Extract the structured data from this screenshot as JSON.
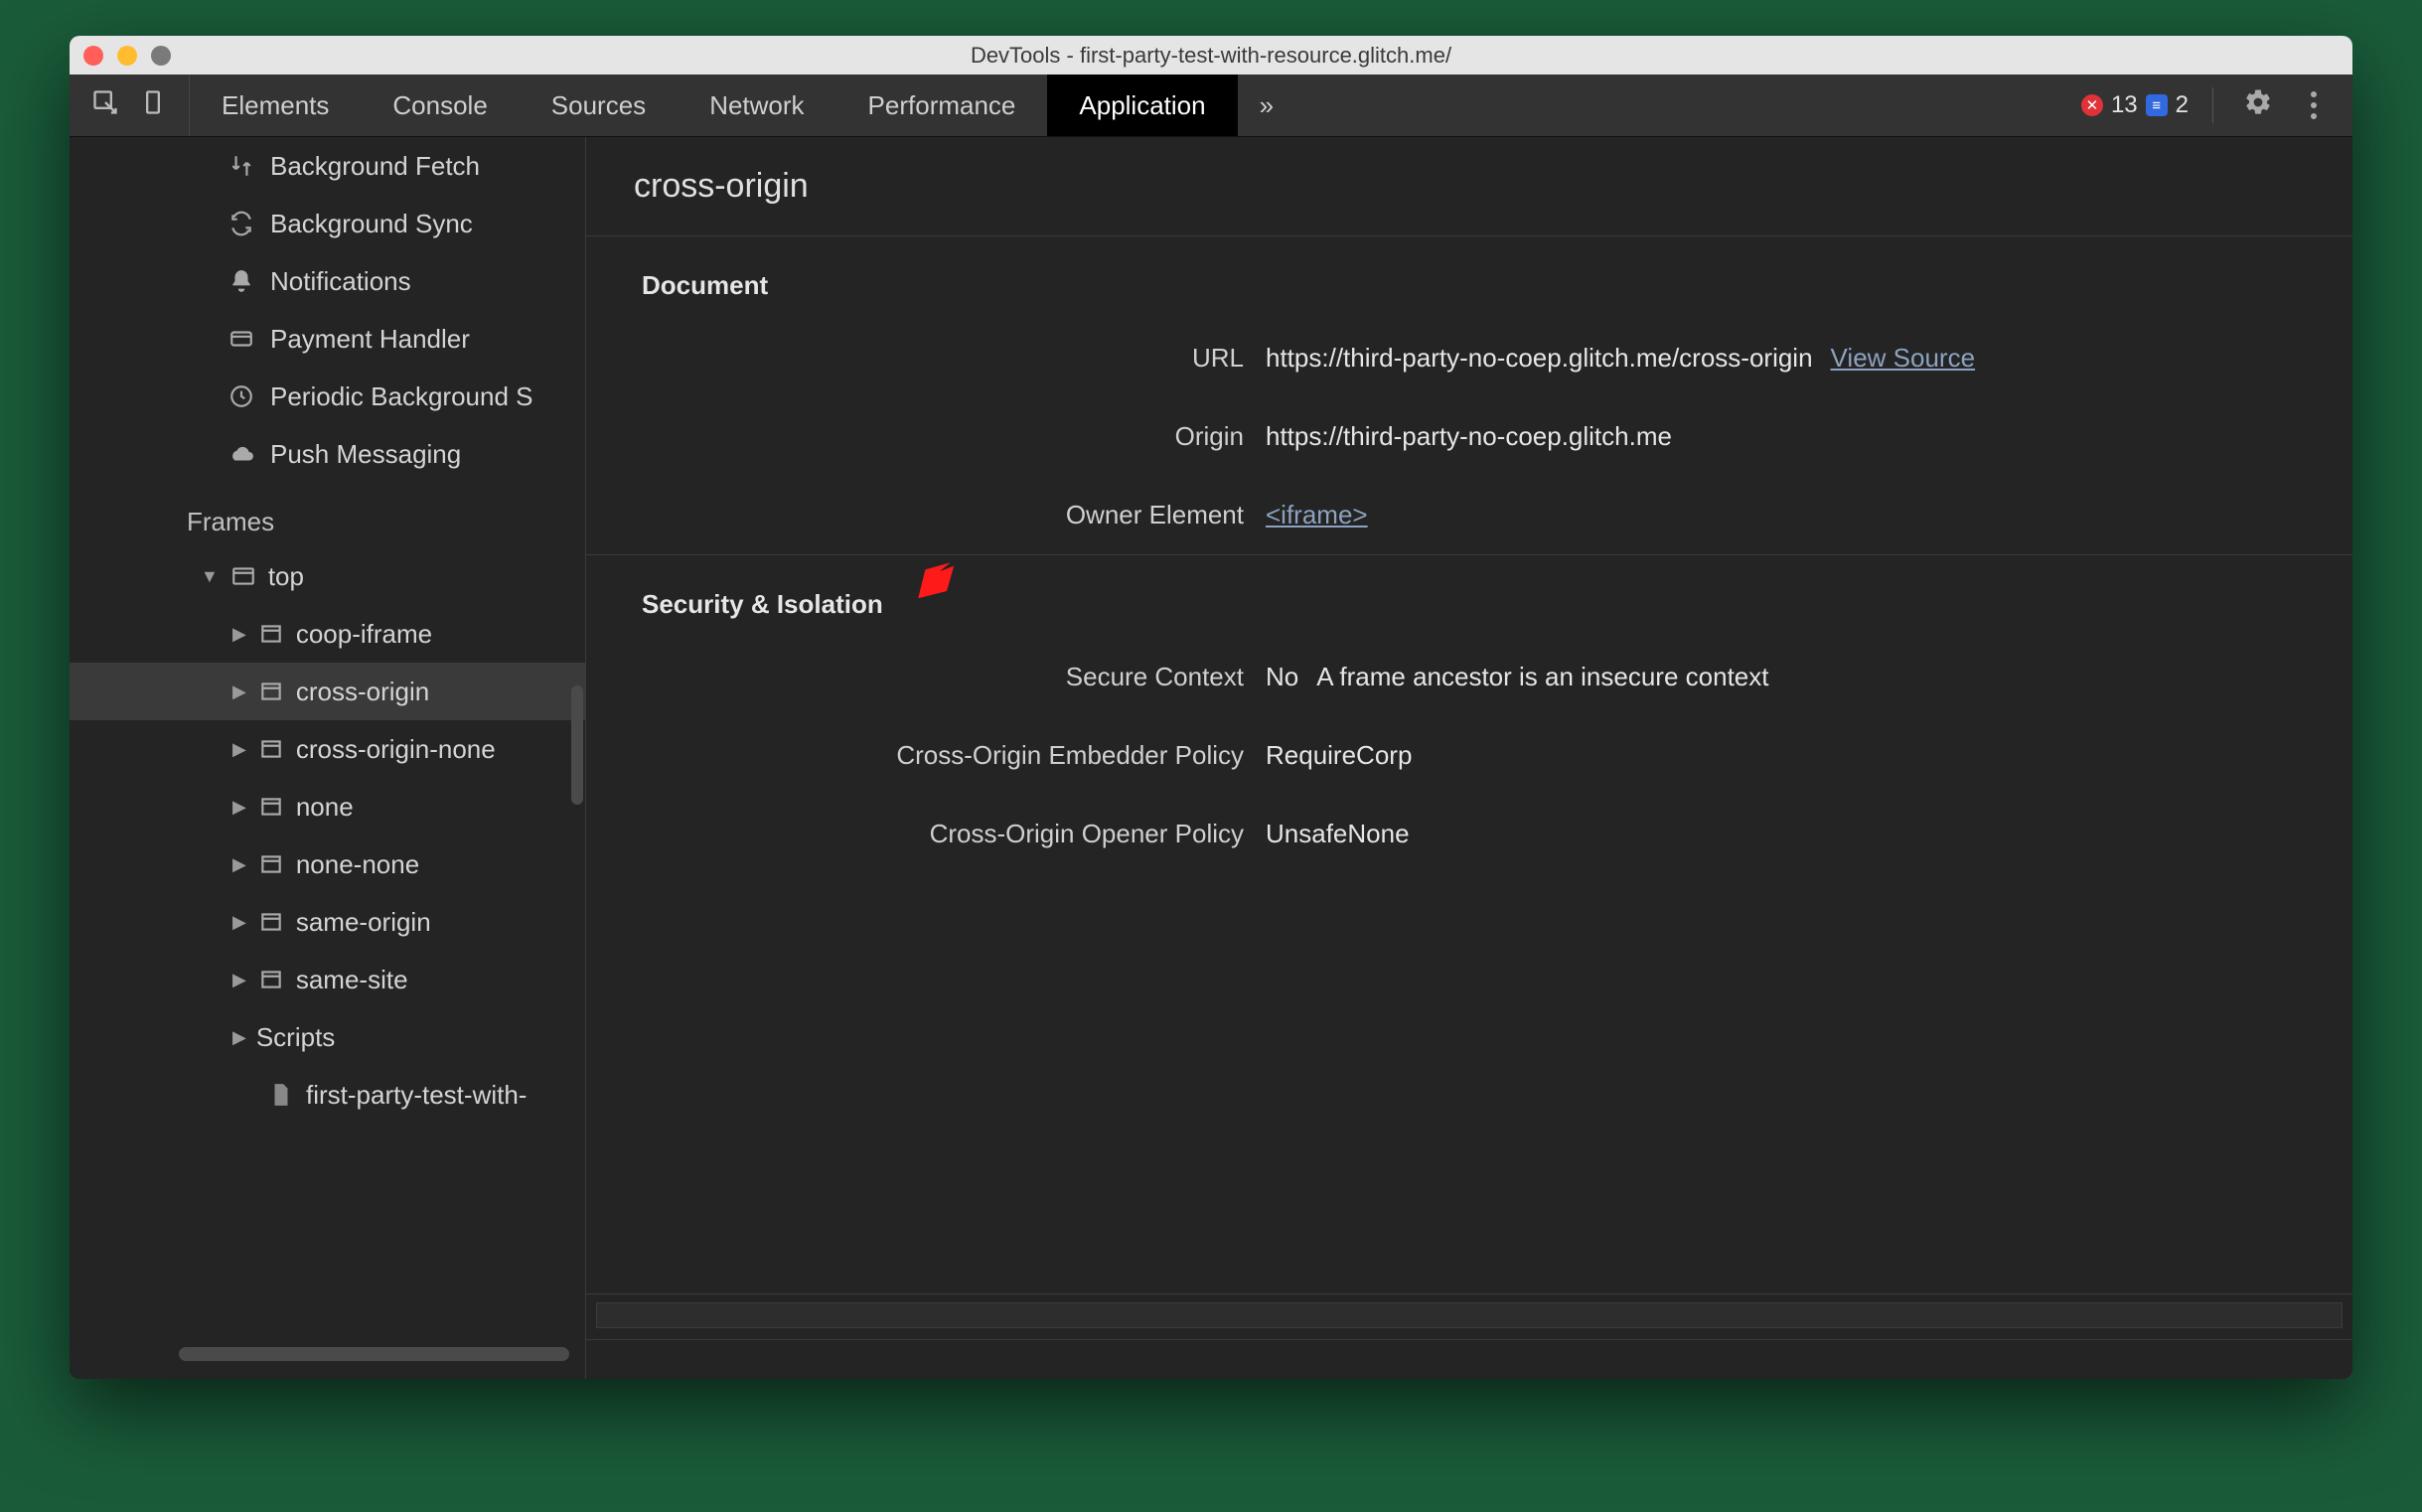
{
  "window": {
    "title": "DevTools - first-party-test-with-resource.glitch.me/"
  },
  "tabs": {
    "items": [
      "Elements",
      "Console",
      "Sources",
      "Network",
      "Performance",
      "Application"
    ],
    "active": "Application",
    "overflow_glyph": "»"
  },
  "status": {
    "error_count": "13",
    "info_count": "2"
  },
  "sidebar": {
    "background_services": [
      {
        "icon": "fetch",
        "label": "Background Fetch"
      },
      {
        "icon": "sync",
        "label": "Background Sync"
      },
      {
        "icon": "bell",
        "label": "Notifications"
      },
      {
        "icon": "card",
        "label": "Payment Handler"
      },
      {
        "icon": "clock",
        "label": "Periodic Background S"
      },
      {
        "icon": "cloud",
        "label": "Push Messaging"
      }
    ],
    "frames_heading": "Frames",
    "tree": {
      "top_label": "top",
      "children": [
        {
          "label": "coop-iframe"
        },
        {
          "label": "cross-origin",
          "selected": true
        },
        {
          "label": "cross-origin-none"
        },
        {
          "label": "none"
        },
        {
          "label": "none-none"
        },
        {
          "label": "same-origin"
        },
        {
          "label": "same-site"
        }
      ],
      "scripts_label": "Scripts",
      "script_item": "first-party-test-with-"
    }
  },
  "content": {
    "title": "cross-origin",
    "document_heading": "Document",
    "document": {
      "url_label": "URL",
      "url_value": "https://third-party-no-coep.glitch.me/cross-origin",
      "view_source": "View Source",
      "origin_label": "Origin",
      "origin_value": "https://third-party-no-coep.glitch.me",
      "owner_label": "Owner Element",
      "owner_value": "<iframe>"
    },
    "security_heading": "Security & Isolation",
    "security": {
      "secure_context_label": "Secure Context",
      "secure_context_value": "No",
      "secure_context_note": "A frame ancestor is an insecure context",
      "coep_label": "Cross-Origin Embedder Policy",
      "coep_value": "RequireCorp",
      "coop_label": "Cross-Origin Opener Policy",
      "coop_value": "UnsafeNone"
    }
  }
}
